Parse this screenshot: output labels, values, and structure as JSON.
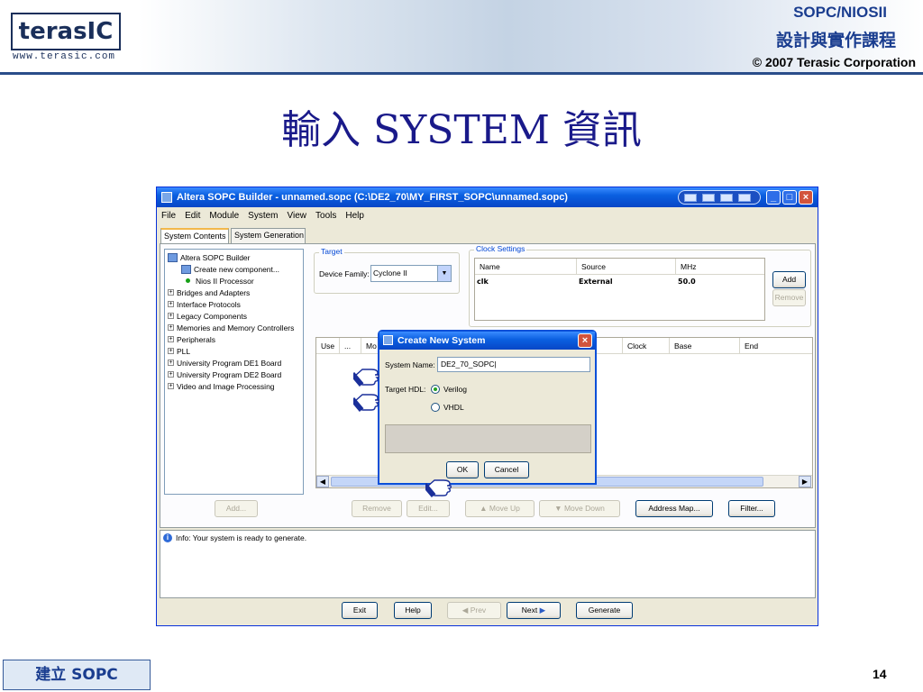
{
  "header": {
    "logo_text": "terasIC",
    "logo_url": "www.terasic.com",
    "course_title": "SOPC/NIOSII",
    "course_subtitle": "設計與實作課程",
    "copyright": "© 2007 Terasic Corporation"
  },
  "slide": {
    "title": "輸入 SYSTEM 資訊",
    "footer_label": "建立 SOPC",
    "page_number": "14"
  },
  "window": {
    "title": "Altera SOPC Builder - unnamed.sopc (C:\\DE2_70\\MY_FIRST_SOPC\\unnamed.sopc)",
    "menu": [
      "File",
      "Edit",
      "Module",
      "System",
      "View",
      "Tools",
      "Help"
    ],
    "tabs": [
      "System Contents",
      "System Generation"
    ],
    "tree": {
      "root": "Altera SOPC Builder",
      "children": [
        "Create new component...",
        "Nios II Processor"
      ],
      "groups": [
        "Bridges and Adapters",
        "Interface Protocols",
        "Legacy Components",
        "Memories and Memory Controllers",
        "Peripherals",
        "PLL",
        "University Program DE1 Board",
        "University Program DE2 Board",
        "Video and Image Processing"
      ]
    },
    "add_label": "Add...",
    "target": {
      "legend": "Target",
      "device_family_label": "Device Family:",
      "device_family_value": "Cyclone II"
    },
    "clock": {
      "legend": "Clock Settings",
      "headers": [
        "Name",
        "Source",
        "MHz"
      ],
      "row": [
        "clk",
        "External",
        "50.0"
      ],
      "add_label": "Add",
      "remove_label": "Remove"
    },
    "connections": {
      "headers": [
        "Use",
        "...",
        "Mo",
        "Clock",
        "Base",
        "End"
      ],
      "scroll_label": "III"
    },
    "buttons": {
      "remove": "Remove",
      "edit": "Edit...",
      "move_up": "Move Up",
      "move_down": "Move Down",
      "address_map": "Address Map...",
      "filter": "Filter..."
    },
    "info_message": "Info: Your system is ready to generate.",
    "bottom_buttons": {
      "exit": "Exit",
      "help": "Help",
      "prev": "Prev",
      "next": "Next",
      "generate": "Generate"
    }
  },
  "dialog": {
    "title": "Create New System",
    "system_name_label": "System Name:",
    "system_name_value": "DE2_70_SOPC",
    "target_hdl_label": "Target HDL:",
    "options": [
      "Verilog",
      "VHDL"
    ],
    "selected": "Verilog",
    "ok_label": "OK",
    "cancel_label": "Cancel"
  },
  "colors": {
    "title_blue": "#1a1a8a",
    "xp_titlebar": "#0a5fe0",
    "header_rule": "#2a4d8a"
  }
}
